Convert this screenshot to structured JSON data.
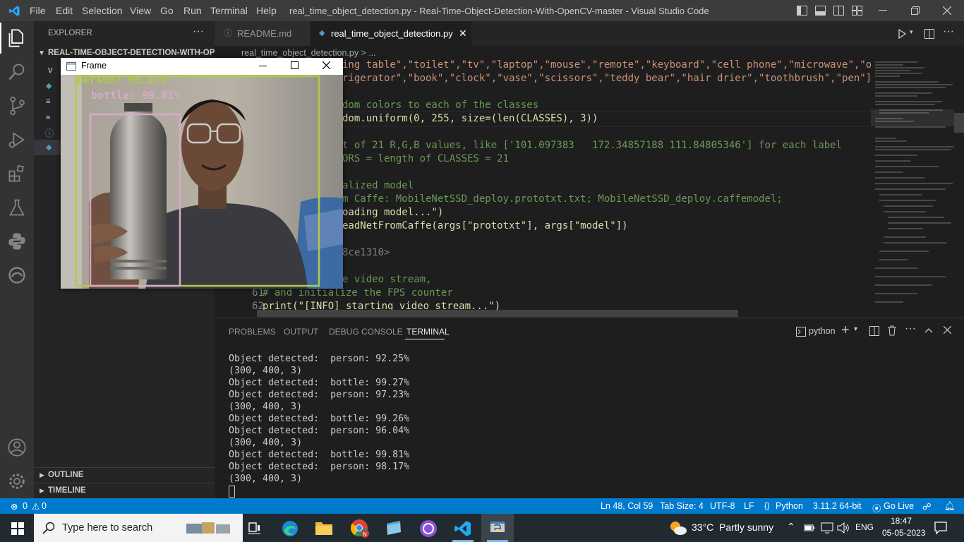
{
  "menu": [
    "File",
    "Edit",
    "Selection",
    "View",
    "Go",
    "Run",
    "Terminal",
    "Help"
  ],
  "window_title": "real_time_object_detection.py - Real-Time-Object-Detection-With-OpenCV-master - Visual Studio Code",
  "sidebar": {
    "header": "EXPLORER",
    "folder": "REAL-TIME-OBJECT-DETECTION-WITH-OPE...",
    "items": [
      "v",
      "",
      "",
      " ",
      "",
      ""
    ],
    "outline": "OUTLINE",
    "timeline": "TIMELINE"
  },
  "tabs": [
    {
      "label": "README.md",
      "active": false
    },
    {
      "label": "real_time_object_detection.py",
      "active": true
    }
  ],
  "breadcrumb": "real_time_object_detection.py > ...",
  "editor": {
    "lines": [
      {
        "n": "",
        "text": "ing table\",\"toilet\",\"tv\",\"laptop\",\"mouse\",\"remote\",\"keyboard\",\"cell phone\",\"microwave\",\"oven\","
      },
      {
        "n": "",
        "text": "rigerator\",\"book\",\"clock\",\"vase\",\"scissors\",\"teddy bear\",\"hair drier\",\"toothbrush\",\"pen\"]"
      },
      {
        "n": "",
        "text": ""
      },
      {
        "n": "",
        "text": "dom colors to each of the classes"
      },
      {
        "n": "",
        "text": "dom.uniform(0, 255, size=(len(CLASSES), 3))"
      },
      {
        "n": "",
        "text": ""
      },
      {
        "n": "",
        "text": "t of 21 R,G,B values, like ['101.097383   172.34857188 111.84805346'] for each label"
      },
      {
        "n": "",
        "text": "ORS = length of CLASSES = 21"
      },
      {
        "n": "",
        "text": ""
      },
      {
        "n": "",
        "text": "alized model"
      },
      {
        "n": "",
        "text": "m Caffe: MobileNetSSD_deploy.prototxt.txt; MobileNetSSD_deploy.caffemodel;"
      },
      {
        "n": "",
        "text": "oading model...\")"
      },
      {
        "n": "",
        "text": "eadNetFromCaffe(args[\"prototxt\"], args[\"model\"])"
      },
      {
        "n": "",
        "text": ""
      },
      {
        "n": "",
        "text": "8ce1310>"
      },
      {
        "n": "",
        "text": ""
      },
      {
        "n": "",
        "text": "e video stream,"
      },
      {
        "n": "61",
        "text": "# and initialize the FPS counter"
      },
      {
        "n": "62",
        "text": "print(\"[INFO] starting video stream...\")"
      }
    ]
  },
  "panel": {
    "tabs": [
      "PROBLEMS",
      "OUTPUT",
      "DEBUG CONSOLE",
      "TERMINAL"
    ],
    "active_tab": "TERMINAL",
    "shell": "python",
    "terminal_lines": [
      "Object detected:  person: 92.25%",
      "(300, 400, 3)",
      "Object detected:  bottle: 99.27%",
      "Object detected:  person: 97.23%",
      "(300, 400, 3)",
      "Object detected:  bottle: 99.26%",
      "Object detected:  person: 96.04%",
      "(300, 400, 3)",
      "Object detected:  bottle: 99.81%",
      "Object detected:  person: 98.17%",
      "(300, 400, 3)"
    ]
  },
  "status": {
    "errors": "0",
    "warnings": "0",
    "position": "Ln 48, Col 59",
    "tab_size": "Tab Size: 4",
    "encoding": "UTF-8",
    "eol": "LF",
    "language": "Python",
    "interpreter": "3.11.2 64-bit",
    "golive": "Go Live"
  },
  "frame_window": {
    "title": "Frame",
    "label_person": "person: 98.17%",
    "label_bottle": "bottle: 99.81%",
    "color_person": "#b4c94a",
    "color_bottle": "#d8a9c7"
  },
  "taskbar": {
    "search_placeholder": "Type here to search",
    "weather": "33°C  Partly sunny",
    "lang": "ENG",
    "time": "18:47",
    "date": "05-05-2023"
  },
  "colors": {
    "accent": "#007acc",
    "activity": "#333333",
    "sidebar": "#252526"
  }
}
